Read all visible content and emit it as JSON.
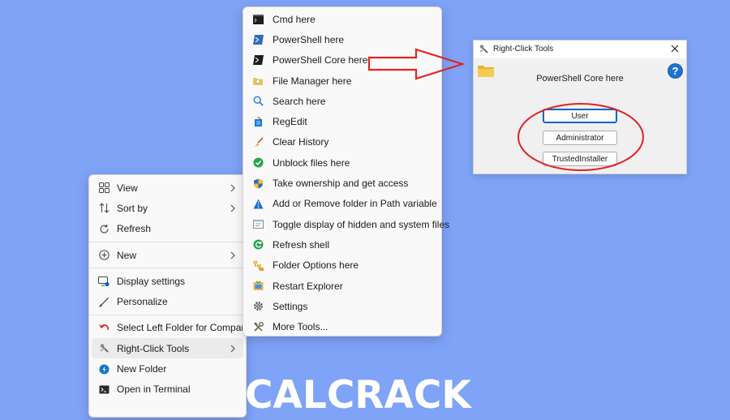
{
  "desktop_menu": {
    "items": [
      {
        "label": "View",
        "icon": "grid-view-icon"
      },
      {
        "label": "Sort by",
        "icon": "sort-icon"
      },
      {
        "label": "Refresh",
        "icon": "refresh-icon"
      },
      {
        "label": "New",
        "icon": "plus-circle-icon"
      },
      {
        "label": "Display settings",
        "icon": "display-settings-icon"
      },
      {
        "label": "Personalize",
        "icon": "brush-icon"
      },
      {
        "label": "Select Left Folder for Compare",
        "icon": "compare-icon"
      },
      {
        "label": "Right-Click Tools",
        "icon": "tools-icon"
      },
      {
        "label": "New Folder",
        "icon": "new-folder-icon"
      },
      {
        "label": "Open in Terminal",
        "icon": "terminal-icon"
      }
    ]
  },
  "tools_menu": {
    "items": [
      {
        "label": "Cmd here",
        "icon": "cmd-icon"
      },
      {
        "label": "PowerShell here",
        "icon": "powershell-icon"
      },
      {
        "label": "PowerShell Core here",
        "icon": "powershell-core-icon"
      },
      {
        "label": "File Manager here",
        "icon": "file-manager-icon"
      },
      {
        "label": "Search here",
        "icon": "search-icon"
      },
      {
        "label": "RegEdit",
        "icon": "regedit-icon"
      },
      {
        "label": "Clear History",
        "icon": "broom-icon"
      },
      {
        "label": "Unblock files here",
        "icon": "check-circle-icon"
      },
      {
        "label": "Take ownership and get access",
        "icon": "shield-icon"
      },
      {
        "label": "Add or Remove folder in Path variable",
        "icon": "path-icon"
      },
      {
        "label": "Toggle display of hidden and system files",
        "icon": "hidden-files-icon"
      },
      {
        "label": "Refresh shell",
        "icon": "refresh-shell-icon"
      },
      {
        "label": "Folder Options here",
        "icon": "folder-options-icon"
      },
      {
        "label": "Restart Explorer",
        "icon": "restart-explorer-icon"
      },
      {
        "label": "Settings",
        "icon": "gear-icon"
      },
      {
        "label": "More Tools...",
        "icon": "more-tools-icon"
      }
    ]
  },
  "dialog": {
    "title": "Right-Click Tools",
    "heading": "PowerShell Core here",
    "buttons": {
      "user": "User",
      "administrator": "Administrator",
      "trustedinstaller": "TrustedInstaller"
    }
  },
  "watermark": "CALCRACK",
  "colors": {
    "background": "#7ea3f7",
    "annotation": "#e02424",
    "accent": "#0067c0"
  }
}
